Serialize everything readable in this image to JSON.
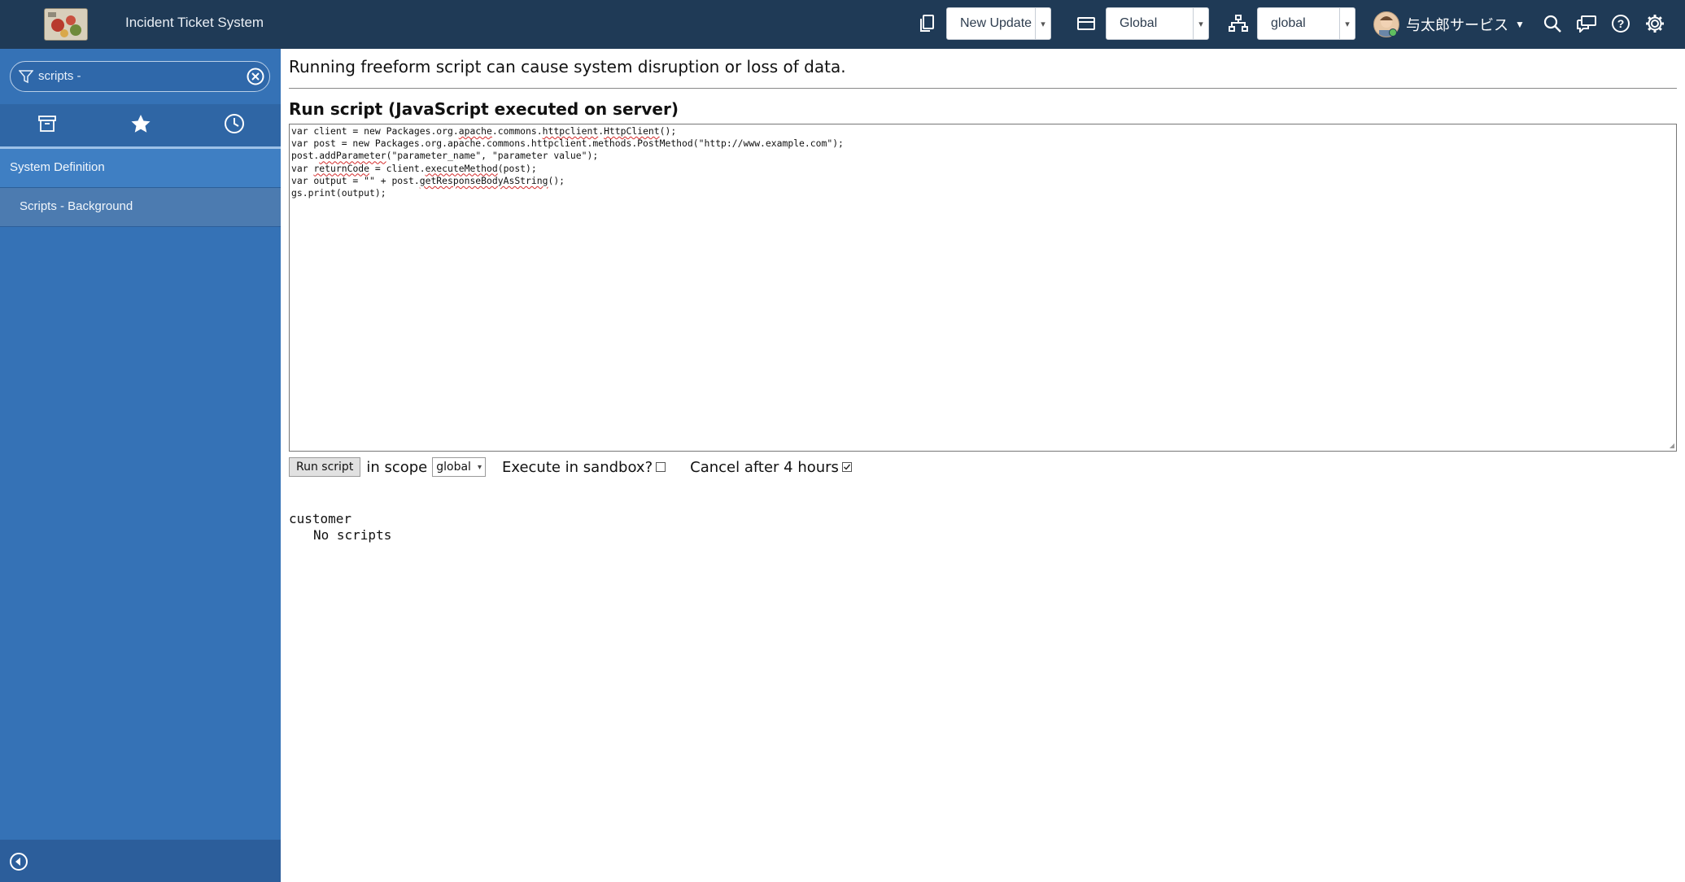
{
  "header": {
    "app_title": "Incident Ticket System",
    "update_set": "New Update",
    "application_scope": "Global",
    "domain": "global",
    "user_name": "与太郎サービス"
  },
  "sidebar": {
    "filter_value": "scripts -",
    "items": [
      {
        "label": "System Definition"
      },
      {
        "label": "Scripts - Background"
      }
    ]
  },
  "main": {
    "warning": "Running freeform script can cause system disruption or loss of data.",
    "section_title": "Run script (JavaScript executed on server)",
    "run_button": "Run script",
    "in_scope_label": "in scope",
    "scope_value": "global",
    "sandbox_label": "Execute in sandbox?",
    "sandbox_checked": false,
    "cancel_label": "Cancel after 4 hours",
    "cancel_checked": true,
    "output_scope": "customer",
    "output_message": "No scripts"
  },
  "script": {
    "l1a": "var client = new Packages.org.",
    "l1b": "apache",
    "l1c": ".commons.",
    "l1d": "httpclient",
    "l1e": ".",
    "l1f": "HttpClient",
    "l1g": "();",
    "l2": "var post = new Packages.org.apache.commons.httpclient.methods.PostMethod(\"http://www.example.com\");",
    "l3a": "post.",
    "l3b": "addParameter",
    "l3c": "(\"parameter_name\", \"parameter value\");",
    "l4a": "var ",
    "l4b": "returnCode",
    "l4c": " = client.",
    "l4d": "executeMethod",
    "l4e": "(post);",
    "l5a": "var output = \"\" + post.",
    "l5b": "getResponseBodyAsString",
    "l5c": "();",
    "l6": "gs.print(output);"
  },
  "colors": {
    "header_bg": "#1f3a56",
    "sidebar_bg": "#3572b6",
    "sidebar_selected": "#4c7bb0",
    "spell_error": "#d42a2a"
  },
  "icons": [
    "update-set-icon",
    "application-icon",
    "domain-icon",
    "search-icon",
    "chat-icon",
    "help-icon",
    "gear-icon",
    "filter-icon",
    "clear-icon",
    "archive-icon",
    "star-icon",
    "clock-icon",
    "collapse-icon"
  ]
}
